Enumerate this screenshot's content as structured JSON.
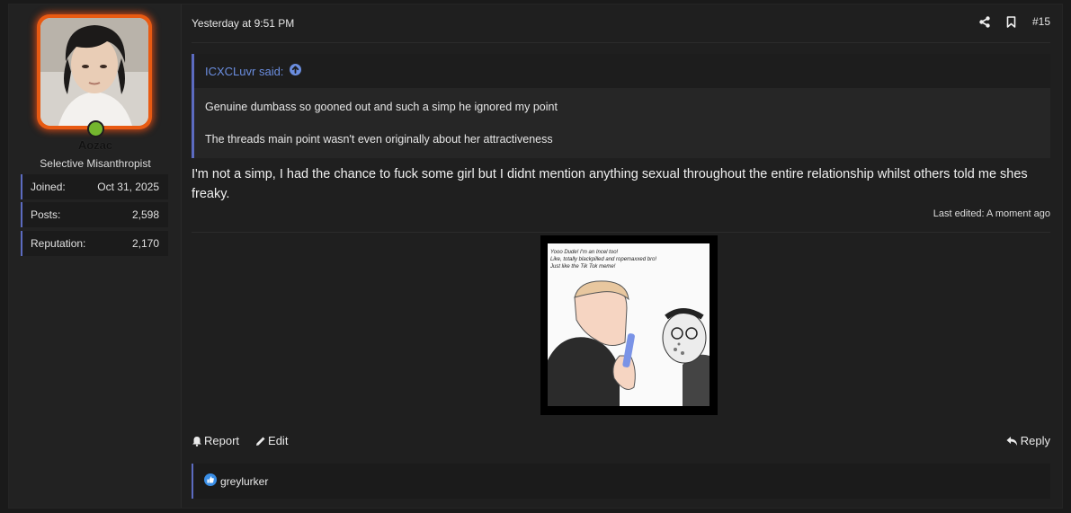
{
  "user": {
    "name": "Aozac",
    "title": "Selective Misanthropist",
    "avatar_border_color": "#e85a12",
    "online_color": "#74b62e",
    "stats": [
      {
        "label": "Joined:",
        "value": "Oct 31, 2025"
      },
      {
        "label": "Posts:",
        "value": "2,598"
      },
      {
        "label": "Reputation:",
        "value": "2,170"
      }
    ]
  },
  "post": {
    "date": "Yesterday at 9:51 PM",
    "number": "#15",
    "icons": [
      "share-icon",
      "bookmark-icon"
    ],
    "quote": {
      "author": "ICXCLuvr said:",
      "lines": [
        "Genuine dumbass so gooned out and such a simp he ignored my point",
        "The threads main point wasn't even originally about her attractiveness"
      ]
    },
    "body": "I'm not a simp, I had the chance to fuck some girl but I didnt mention anything sexual throughout the entire relationship whilst others told me shes freaky.",
    "edited": "Last edited: A moment ago",
    "attachment": {
      "text_lines": [
        "Yooo Dude! I'm an Incel too!",
        "Like, totally blackpilled and ropemaxxed bro!",
        "Just like the Tik Tok meme!"
      ]
    },
    "actions": {
      "report": "Report",
      "edit": "Edit",
      "reply": "Reply"
    },
    "reactions": {
      "user": "greylurker"
    }
  },
  "colors": {
    "accent": "#5c6bc0",
    "link": "#6b8ee0"
  }
}
